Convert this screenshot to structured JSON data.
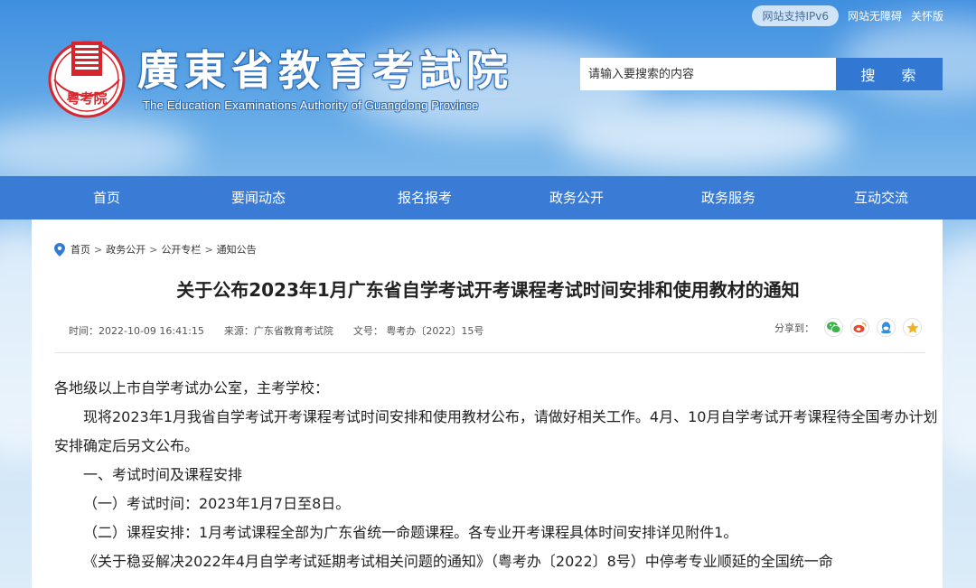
{
  "header": {
    "ipv6_badge": "网站支持IPv6",
    "accessibility_link": "网站无障碍",
    "care_link": "关怀版",
    "brand_cn": "廣東省教育考試院",
    "brand_en": "The Education Examinations Authority of Guangdong Province",
    "seal_text": "粤考院"
  },
  "search": {
    "placeholder": "请输入要搜索的内容",
    "button_label": "搜 索"
  },
  "nav": {
    "items": [
      "首页",
      "要闻动态",
      "报名报考",
      "政务公开",
      "政务服务",
      "互动交流"
    ]
  },
  "breadcrumb": {
    "items": [
      "首页",
      "政务公开",
      "公开专栏",
      "通知公告"
    ],
    "separator": ">"
  },
  "article": {
    "title": "关于公布2023年1月广东省自学考试开考课程考试时间安排和使用教材的通知",
    "time": "时间：2022-10-09 16:41:15",
    "source": "来源：广东省教育考试院",
    "doc_no": "文号：  粤考办〔2022〕15号",
    "share_label": "分享到：",
    "paragraphs": [
      "各地级以上市自学考试办公室，主考学校：",
      "现将2023年1月我省自学考试开考课程考试时间安排和使用教材公布，请做好相关工作。4月、10月自学考试开考课程待全国考办计划安排确定后另文公布。",
      "一、考试时间及课程安排",
      "（一）考试时间：2023年1月7日至8日。",
      "（二）课程安排：1月考试课程全部为广东省统一命题课程。各专业开考课程具体时间安排详见附件1。",
      "《关于稳妥解决2022年4月自学考试延期考试相关问题的通知》（粤考办〔2022〕8号）中停考专业顺延的全国统一命"
    ]
  },
  "colors": {
    "nav_bg": "#3a7bd6",
    "search_button": "#3277d2",
    "seal_red": "#d9242c",
    "pin_blue": "#2f7bd8",
    "wechat_green": "#3bb54a",
    "weibo_red": "#e6492d",
    "qq_blue": "#2f8fe0",
    "qzone_yellow": "#f2b31b"
  }
}
